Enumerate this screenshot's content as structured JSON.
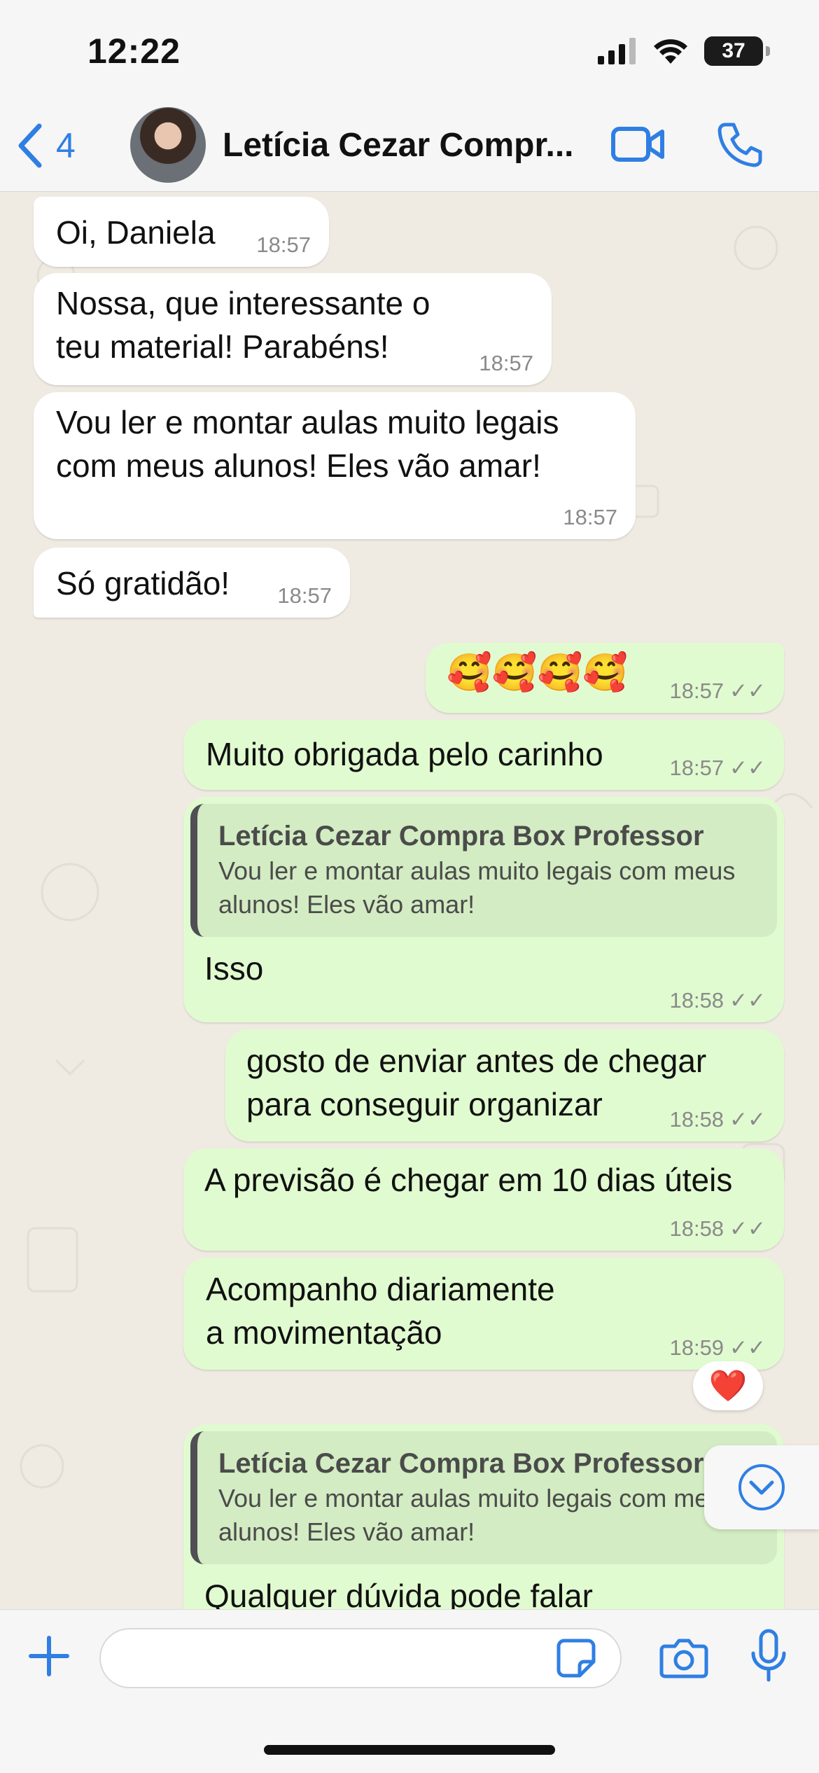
{
  "status_bar": {
    "time": "12:22",
    "battery": "37"
  },
  "header": {
    "back_count": "4",
    "contact_name": "Letícia Cezar Compr..."
  },
  "messages": [
    {
      "dir": "in",
      "text": "Oi, Daniela",
      "time": "18:57"
    },
    {
      "dir": "in",
      "text": "Nossa, que interessante o teu material! Parabéns!",
      "time": "18:57"
    },
    {
      "dir": "in",
      "text": "Vou ler e montar aulas muito legais com meus alunos! Eles vão amar!",
      "time": "18:57"
    },
    {
      "dir": "in",
      "text": "Só gratidão!",
      "time": "18:57"
    },
    {
      "dir": "out",
      "text": "🥰🥰🥰🥰",
      "time": "18:57"
    },
    {
      "dir": "out",
      "text": "Muito obrigada pelo carinho",
      "time": "18:57"
    },
    {
      "dir": "out",
      "quote_name": "Letícia Cezar Compra Box Professor",
      "quote_text": "Vou ler e montar aulas muito legais com meus alunos! Eles vão amar!",
      "text": "Isso",
      "time": "18:58"
    },
    {
      "dir": "out",
      "text": "gosto de enviar antes de chegar para conseguir organizar",
      "time": "18:58"
    },
    {
      "dir": "out",
      "text": "A previsão é chegar em 10 dias úteis",
      "time": "18:58"
    },
    {
      "dir": "out",
      "text": "Acompanho diariamente a movimentação",
      "time": "18:59",
      "reaction": "❤️"
    },
    {
      "dir": "out",
      "quote_name": "Letícia Cezar Compra Box Professor",
      "quote_text": "Vou ler e montar aulas muito legais com meus alunos! Eles vão amar!",
      "text": "Qualquer dúvida pode falar",
      "time": ""
    }
  ],
  "input": {
    "placeholder": ""
  },
  "colors": {
    "accent": "#2f7fe3",
    "outgoing": "#e1fbd0",
    "incoming": "#ffffff",
    "background": "#efeae2"
  }
}
